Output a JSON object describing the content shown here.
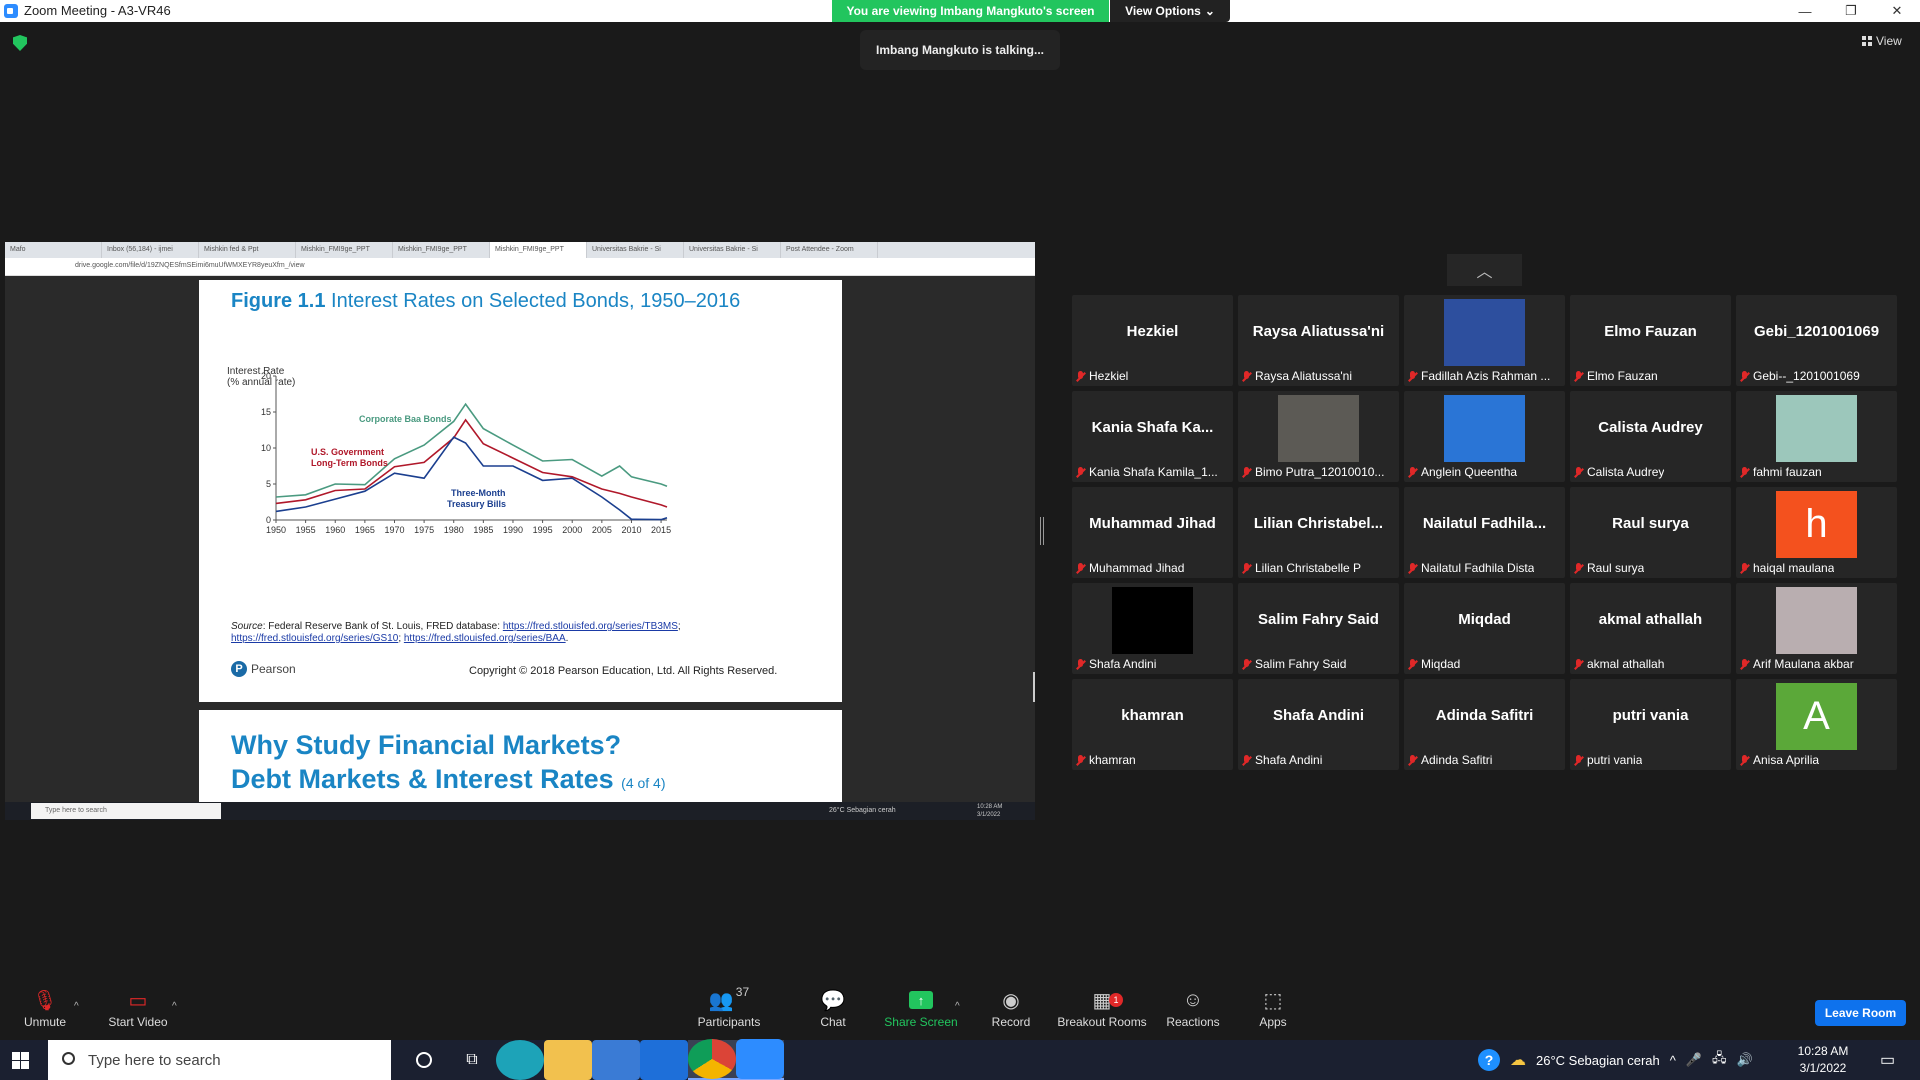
{
  "window": {
    "title": "Zoom Meeting - A3-VR46",
    "viewing_banner": "You are viewing Imbang Mangkuto's screen",
    "view_options": "View Options",
    "talking": "Imbang Mangkuto is talking...",
    "view_label": "View"
  },
  "browser": {
    "tabs": [
      "Mafo",
      "Inbox (56,184) - ijmei",
      "Mishkin fed & Ppt",
      "Mishkin_FMI9ge_PPT",
      "Mishkin_FMI9ge_PPT",
      "Mishkin_FMI9ge_PPT",
      "Universitas Bakrie - Si",
      "Universitas Bakrie - Si",
      "Post Attendee - Zoom"
    ],
    "url": "drive.google.com/file/d/19ZNQESfmSEimi6muUfWMXEYR8yeuXfm_/view"
  },
  "slide": {
    "fig_num": "Figure 1.1",
    "fig_title": " Interest Rates on Selected Bonds, 1950–2016",
    "ylabel_line1": "Interest Rate",
    "ylabel_line2": "(% annual rate)",
    "source_label": "Source",
    "source_text": ": Federal Reserve Bank of St. Louis, FRED database: ",
    "link1": "https://fred.stlouisfed.org/series/TB3MS",
    "link2": "https://fred.stlouisfed.org/series/GS10",
    "link3": "https://fred.stlouisfed.org/series/BAA",
    "publisher": "Pearson",
    "copyright": "Copyright © 2018 Pearson Education, Ltd. All Rights Reserved.",
    "next_title1": "Why Study Financial Markets?",
    "next_title2": "Debt Markets & Interest Rates",
    "next_page": "(4 of 4)"
  },
  "chart_data": {
    "type": "line",
    "title": "Figure 1.1 Interest Rates on Selected Bonds, 1950–2016",
    "ylabel": "Interest Rate (% annual rate)",
    "xlim": [
      1950,
      2016
    ],
    "ylim": [
      0,
      20
    ],
    "x_ticks": [
      1950,
      1955,
      1960,
      1965,
      1970,
      1975,
      1980,
      1985,
      1990,
      1995,
      2000,
      2005,
      2010,
      2015
    ],
    "y_ticks": [
      0,
      5,
      10,
      15,
      20
    ],
    "x": [
      1950,
      1955,
      1960,
      1965,
      1970,
      1975,
      1980,
      1982,
      1985,
      1990,
      1995,
      2000,
      2005,
      2008,
      2010,
      2015,
      2016
    ],
    "series": [
      {
        "name": "Corporate Baa Bonds",
        "color": "#4a9a80",
        "values": [
          3.2,
          3.5,
          5.0,
          4.9,
          8.5,
          10.4,
          13.7,
          16.1,
          12.7,
          10.4,
          8.2,
          8.4,
          6.1,
          7.5,
          6.0,
          5.0,
          4.7
        ]
      },
      {
        "name": "U.S. Government Long-Term Bonds",
        "color": "#b0182a",
        "values": [
          2.3,
          2.8,
          4.1,
          4.3,
          7.4,
          8.0,
          11.4,
          13.9,
          10.6,
          8.6,
          6.6,
          6.0,
          4.3,
          3.7,
          3.2,
          2.1,
          1.8
        ]
      },
      {
        "name": "Three-Month Treasury Bills",
        "color": "#1b3f8f",
        "values": [
          1.2,
          1.8,
          2.9,
          4.0,
          6.5,
          5.8,
          11.5,
          10.7,
          7.5,
          7.5,
          5.5,
          5.8,
          3.2,
          1.4,
          0.1,
          0.05,
          0.3
        ]
      }
    ]
  },
  "chart_labels": {
    "baa": "Corporate Baa Bonds",
    "gov1": "U.S. Government",
    "gov2": "Long-Term Bonds",
    "tb1": "Three-Month",
    "tb2": "Treasury Bills"
  },
  "inner_taskbar": {
    "search": "Type here to search",
    "weather": "26°C  Sebagian cerah",
    "time": "10:28 AM",
    "date": "3/1/2022"
  },
  "participants": [
    {
      "display": "Hezkiel",
      "label": "Hezkiel",
      "type": "name"
    },
    {
      "display": "Raysa Aliatussa'ni",
      "label": "Raysa Aliatussa'ni",
      "type": "name"
    },
    {
      "display": "",
      "label": "Fadillah Azis Rahman ...",
      "type": "photo",
      "color": "#2d4f9e"
    },
    {
      "display": "Elmo Fauzan",
      "label": "Elmo Fauzan",
      "type": "name"
    },
    {
      "display": "Gebi_1201001069",
      "label": "Gebi--_1201001069",
      "type": "name"
    },
    {
      "display": "Kania Shafa Ka...",
      "label": "Kania Shafa Kamila_1...",
      "type": "name"
    },
    {
      "display": "",
      "label": "Bimo Putra_12010010...",
      "type": "photo",
      "color": "#5c5a55"
    },
    {
      "display": "",
      "label": "Anglein Queentha",
      "type": "photo",
      "color": "#2a75d6"
    },
    {
      "display": "Calista Audrey",
      "label": "Calista Audrey",
      "type": "name"
    },
    {
      "display": "",
      "label": "fahmi fauzan",
      "type": "photo",
      "color": "#9cc7bb"
    },
    {
      "display": "Muhammad Jihad",
      "label": "Muhammad Jihad",
      "type": "name"
    },
    {
      "display": "Lilian  Christabel...",
      "label": "Lilian Christabelle P",
      "type": "name"
    },
    {
      "display": "Nailatul  Fadhila...",
      "label": "Nailatul Fadhila Dista",
      "type": "name"
    },
    {
      "display": "Raul surya",
      "label": "Raul surya",
      "type": "name"
    },
    {
      "display": "h",
      "label": "haiqal maulana",
      "type": "letter",
      "color": "#f4511e"
    },
    {
      "display": "",
      "label": "Shafa Andini",
      "type": "photo",
      "color": "#000000"
    },
    {
      "display": "Salim Fahry Said",
      "label": "Salim Fahry Said",
      "type": "name"
    },
    {
      "display": "Miqdad",
      "label": "Miqdad",
      "type": "name"
    },
    {
      "display": "akmal athallah",
      "label": "akmal athallah",
      "type": "name"
    },
    {
      "display": "",
      "label": "Arif Maulana akbar",
      "type": "photo",
      "color": "#b9aeb0"
    },
    {
      "display": "khamran",
      "label": "khamran",
      "type": "name"
    },
    {
      "display": "Shafa Andini",
      "label": "Shafa Andini",
      "type": "name"
    },
    {
      "display": "Adinda Safitri",
      "label": "Adinda Safitri",
      "type": "name"
    },
    {
      "display": "putri vania",
      "label": "putri vania",
      "type": "name"
    },
    {
      "display": "A",
      "label": "Anisa Aprilia",
      "type": "letter",
      "color": "#5ba839"
    }
  ],
  "toolbar": {
    "unmute": "Unmute",
    "start_video": "Start Video",
    "participants": "Participants",
    "participants_count": "37",
    "chat": "Chat",
    "share_screen": "Share Screen",
    "record": "Record",
    "breakout": "Breakout Rooms",
    "breakout_badge": "1",
    "reactions": "Reactions",
    "apps": "Apps",
    "leave": "Leave Room"
  },
  "taskbar": {
    "search": "Type here to search",
    "weather": "26°C  Sebagian cerah",
    "time": "10:28 AM",
    "date": "3/1/2022"
  }
}
